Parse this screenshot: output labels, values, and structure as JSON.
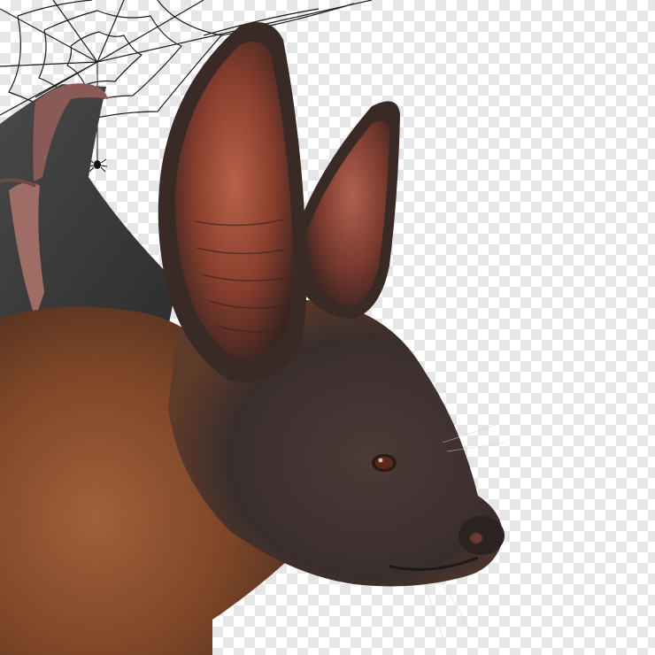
{
  "image": {
    "subject": "bat",
    "background": "transparent-checkerboard",
    "elements": [
      "spider-web",
      "hanging-spider",
      "bat-wing",
      "bat-ear-left",
      "bat-ear-right",
      "bat-head",
      "bat-body-fur",
      "bat-eye",
      "bat-nose"
    ]
  },
  "colors": {
    "checker_light": "#ffffff",
    "checker_dark": "#e6e6e6",
    "fur": "#8a4e2e",
    "fur_dark": "#4b3026",
    "ear_inner": "#9c4a36",
    "ear_edge": "#3a2a26",
    "wing": "#3c3b3c",
    "wing_bone": "#a06c66",
    "face": "#3d3232",
    "eye": "#5a2a18",
    "nose": "#2b2222",
    "web": "#1a1a1a"
  }
}
